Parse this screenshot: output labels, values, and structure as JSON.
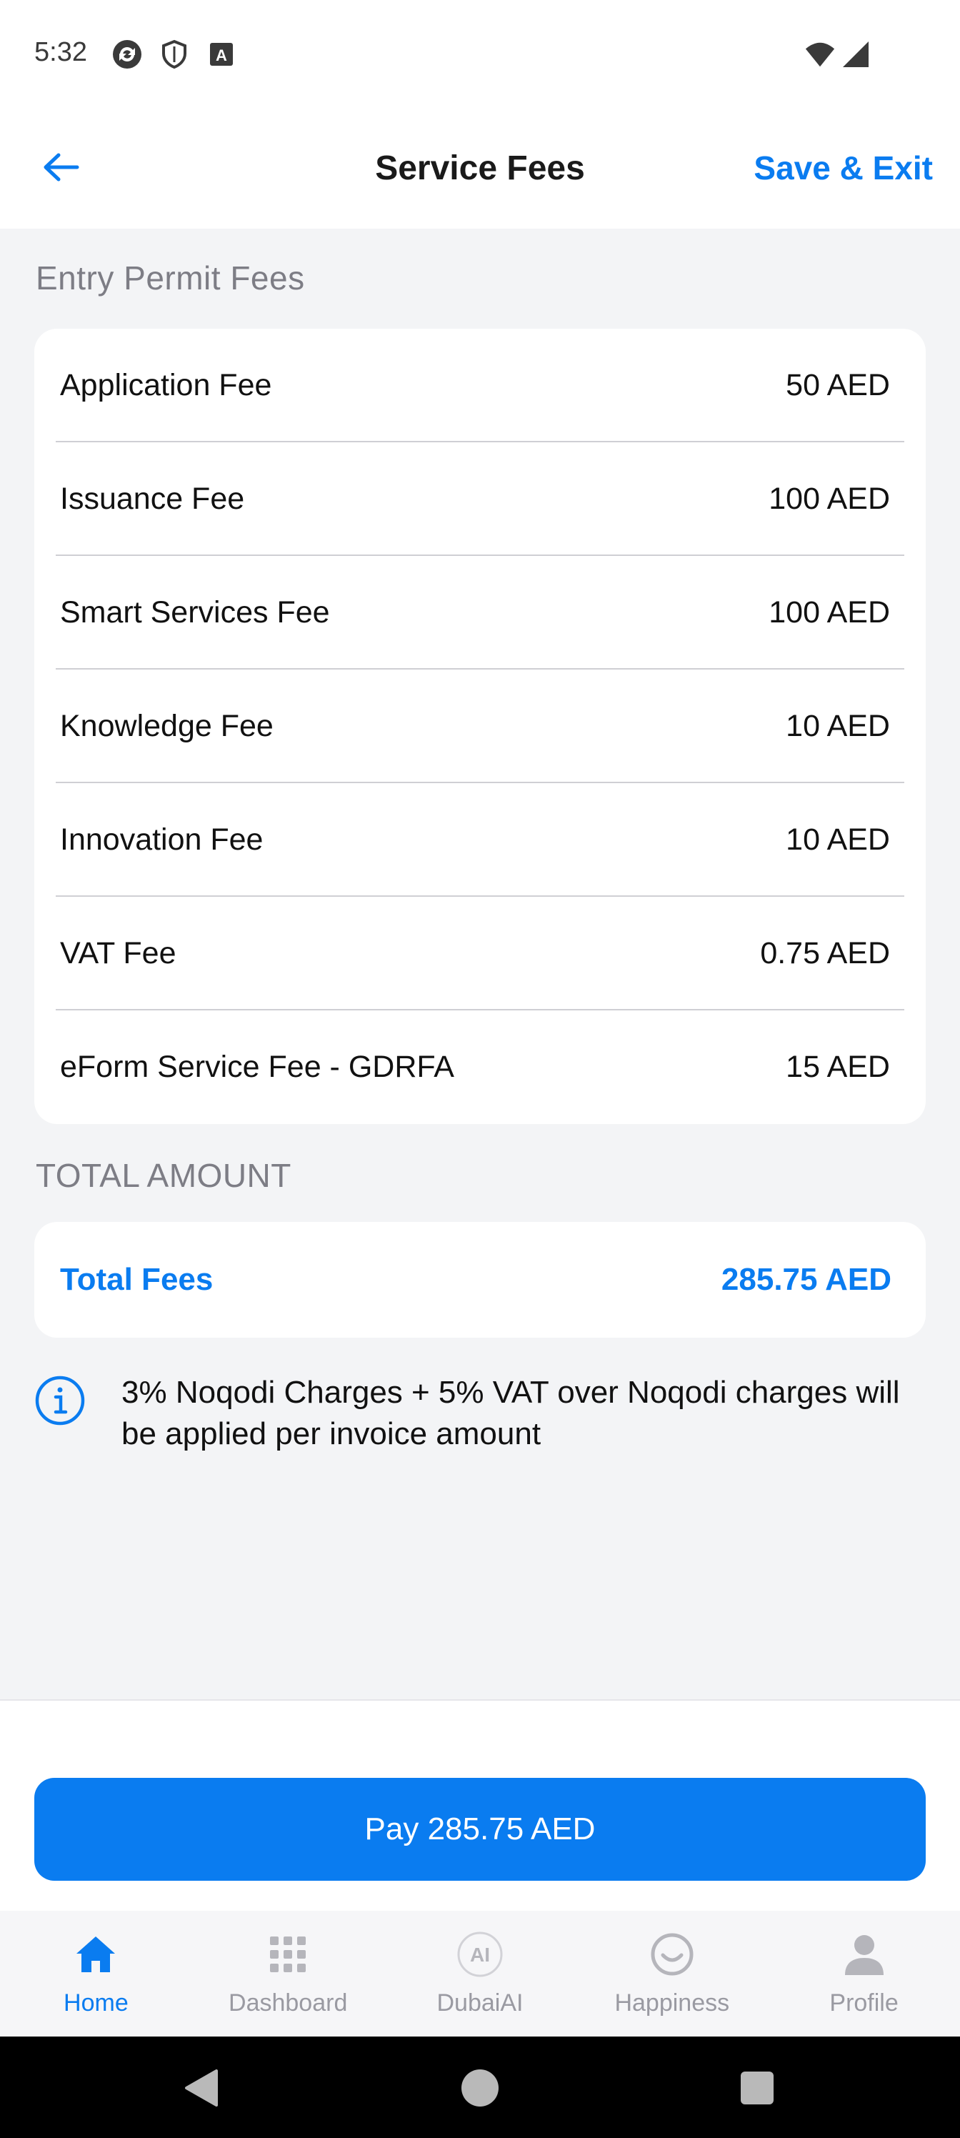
{
  "status_bar": {
    "time": "5:32",
    "icons": [
      "sync-icon",
      "shield-icon",
      "a-box-icon",
      "wifi-icon",
      "signal-icon"
    ]
  },
  "header": {
    "title": "Service Fees",
    "save_exit": "Save & Exit",
    "back_icon": "arrow-left-icon"
  },
  "entry_permit": {
    "section_title": "Entry Permit Fees",
    "fees": [
      {
        "label": "Application Fee",
        "value": "50 AED"
      },
      {
        "label": "Issuance Fee",
        "value": "100 AED"
      },
      {
        "label": "Smart Services Fee",
        "value": "100 AED"
      },
      {
        "label": "Knowledge Fee",
        "value": "10 AED"
      },
      {
        "label": "Innovation Fee",
        "value": "10 AED"
      },
      {
        "label": "VAT Fee",
        "value": "0.75 AED"
      },
      {
        "label": "eForm Service Fee - GDRFA",
        "value": "15 AED"
      }
    ]
  },
  "total": {
    "section_title": "TOTAL AMOUNT",
    "label": "Total Fees",
    "value": "285.75 AED"
  },
  "note": {
    "text": "3% Noqodi Charges + 5% VAT over Noqodi charges will be applied per invoice amount",
    "icon": "info-icon"
  },
  "pay_button": {
    "label": "Pay 285.75 AED"
  },
  "bottom_nav": {
    "items": [
      {
        "label": "Home",
        "icon": "home-icon",
        "active": true
      },
      {
        "label": "Dashboard",
        "icon": "grid-icon",
        "active": false
      },
      {
        "label": "DubaiAI",
        "icon": "ai-icon",
        "active": false
      },
      {
        "label": "Happiness",
        "icon": "smiley-icon",
        "active": false
      },
      {
        "label": "Profile",
        "icon": "person-icon",
        "active": false
      }
    ]
  },
  "colors": {
    "accent": "#0a7cf0",
    "background": "#f3f4f6",
    "card": "#ffffff",
    "muted": "#7d7d85"
  }
}
